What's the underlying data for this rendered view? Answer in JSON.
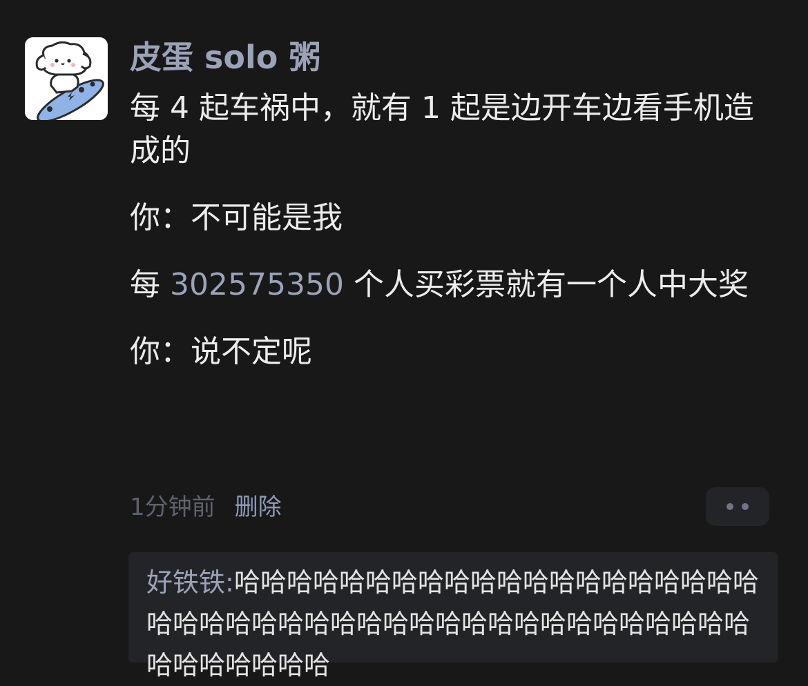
{
  "post": {
    "username": "皮蛋 solo 粥",
    "lines": {
      "l1": "每 4 起车祸中，就有 1 起是边开车边看手机造成的",
      "l2": "你：不可能是我",
      "l3_prefix": "每 ",
      "l3_number": "302575350",
      "l3_suffix": " 个人买彩票就有一个人中大奖",
      "l4": "你：说不定呢"
    },
    "avatar_icon": "dog-on-skateboard-avatar"
  },
  "meta": {
    "time": "1分钟前",
    "delete_label": "删除",
    "more_icon": "more-dots-icon"
  },
  "reply": {
    "author": "好铁铁:",
    "text": "哈哈哈哈哈哈哈哈哈哈哈哈哈哈哈哈哈哈哈哈哈哈哈哈哈哈哈哈哈哈哈哈哈哈哈哈哈哈哈哈哈哈哈哈哈哈哈哈哈哈"
  },
  "colors": {
    "background": "#181818",
    "accent": "#9aa3b8",
    "text": "#ececec",
    "muted": "#5e6270"
  }
}
